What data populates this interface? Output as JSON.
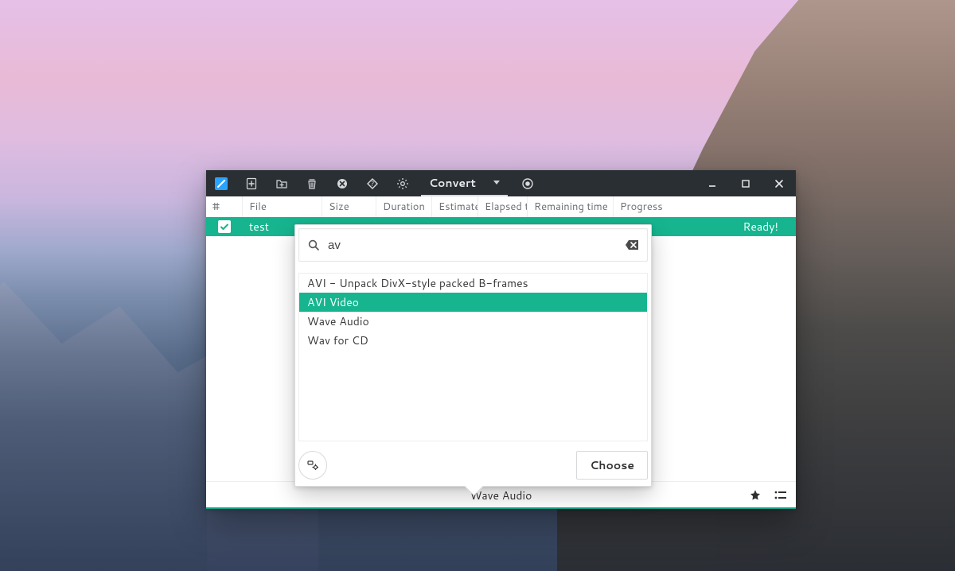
{
  "colors": {
    "accent": "#16b58f",
    "titlebar": "#2a2f33"
  },
  "titlebar": {
    "menu_label": "Convert"
  },
  "columns": {
    "number": "#",
    "file": "File",
    "size": "Size",
    "duration": "Duration",
    "estimate": "Estimate",
    "elapsed": "Elapsed t",
    "remaining": "Remaining time",
    "progress": "Progress"
  },
  "rows": [
    {
      "checked": true,
      "file": "test",
      "status": "Ready!"
    }
  ],
  "footer": {
    "current_format_label": "Wave Audio"
  },
  "popover": {
    "search_value": "av",
    "choose_label": "Choose",
    "options": [
      {
        "label": "AVI - Unpack DivX-style packed B-frames",
        "selected": false
      },
      {
        "label": "AVI Video",
        "selected": true
      },
      {
        "label": "Wave Audio",
        "selected": false
      },
      {
        "label": "Wav for CD",
        "selected": false
      }
    ]
  }
}
